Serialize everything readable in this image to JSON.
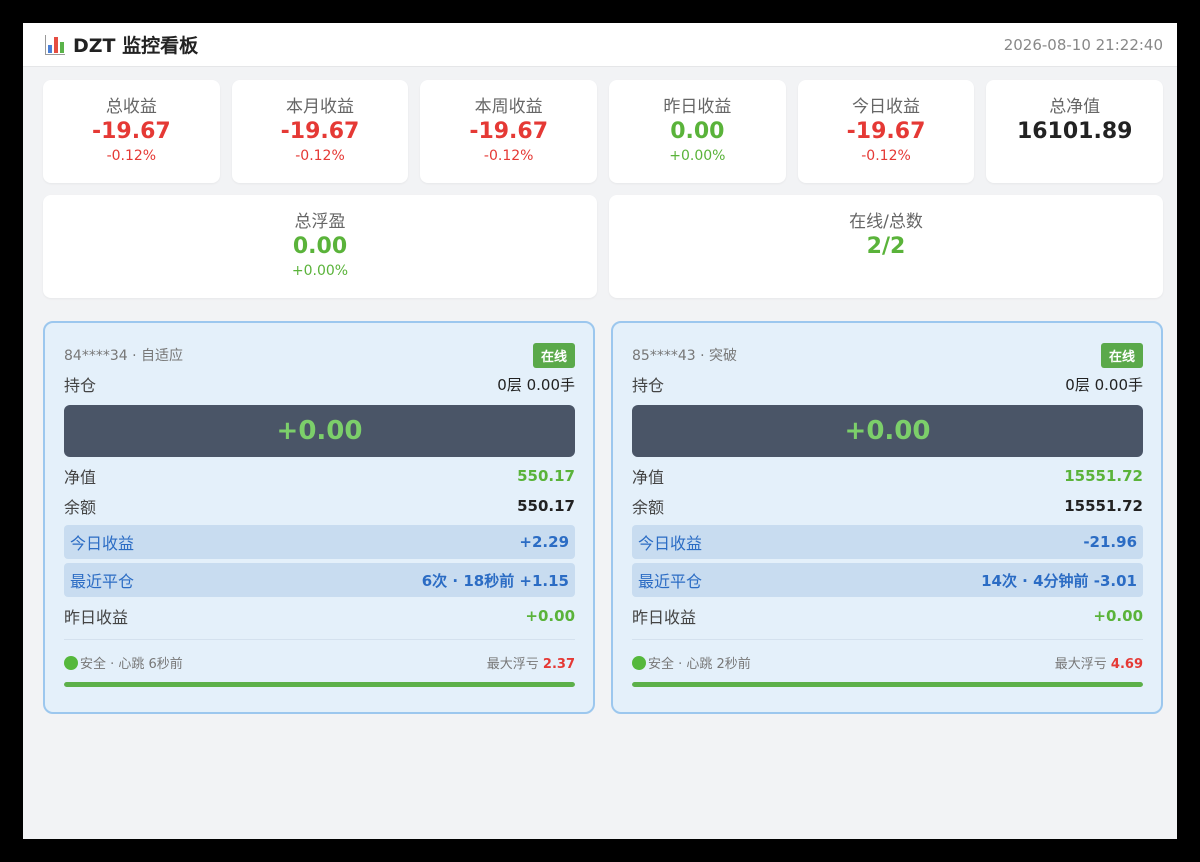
{
  "header": {
    "title": "DZT 监控看板",
    "timestamp": "2026-08-10 21:22:40"
  },
  "stats_row1": [
    {
      "label": "总收益",
      "value": "-19.67",
      "pct": "-0.12%"
    },
    {
      "label": "本月收益",
      "value": "-19.67",
      "pct": "-0.12%"
    },
    {
      "label": "本周收益",
      "value": "-19.67",
      "pct": "-0.12%"
    },
    {
      "label": "昨日收益",
      "value": "0.00",
      "pct": "+0.00%"
    },
    {
      "label": "今日收益",
      "value": "-19.67",
      "pct": "-0.12%"
    },
    {
      "label": "总净值",
      "value": "16101.89"
    }
  ],
  "stats_row2": [
    {
      "label": "总浮盈",
      "value": "0.00",
      "pct": "+0.00%"
    },
    {
      "label": "在线/总数",
      "value": "2/2"
    }
  ],
  "accounts": [
    {
      "account": "84****34 · 自适应",
      "status": "在线",
      "position_label": "持仓",
      "position_value": "0层 0.00手",
      "floating_pnl": "+0.00",
      "equity_label": "净值",
      "equity_value": "550.17",
      "balance_label": "余额",
      "balance_value": "550.17",
      "today_label": "今日收益",
      "today_value": "+2.29",
      "recent_label": "最近平仓",
      "recent_value": "6次 · 18秒前 +1.15",
      "yesterday_label": "昨日收益",
      "yesterday_value": "+0.00",
      "safety_text": "安全 · 心跳 6秒前",
      "max_dd_label": "最大浮亏",
      "max_dd_value": "2.37",
      "progress": 1.0
    },
    {
      "account": "85****43 · 突破",
      "status": "在线",
      "position_label": "持仓",
      "position_value": "0层 0.00手",
      "floating_pnl": "+0.00",
      "equity_label": "净值",
      "equity_value": "15551.72",
      "balance_label": "余额",
      "balance_value": "15551.72",
      "today_label": "今日收益",
      "today_value": "-21.96",
      "recent_label": "最近平仓",
      "recent_value": "14次 · 4分钟前 -3.01",
      "yesterday_label": "昨日收益",
      "yesterday_value": "+0.00",
      "safety_text": "安全 · 心跳 2秒前",
      "max_dd_label": "最大浮亏",
      "max_dd_value": "4.69",
      "progress": 1.0
    }
  ],
  "colors": {
    "negative": "#e53935",
    "positive": "#5ab33a",
    "online": "#5aa94a",
    "card_border": "#9cc7ee",
    "pnl_box": "#4a5567"
  }
}
